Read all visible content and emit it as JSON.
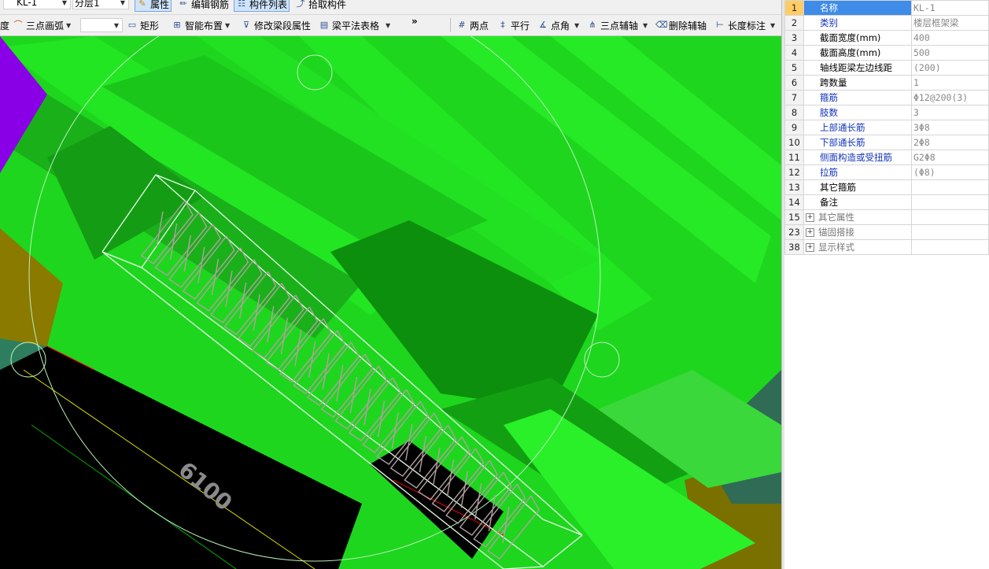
{
  "toolbar1": {
    "component_select": "KL-1",
    "layer_select": "分层1",
    "properties_label": "属性",
    "edit_rebar_label": "编辑钢筋",
    "component_list_label": "构件列表",
    "pick_component_label": "拾取构件"
  },
  "toolbar2": {
    "cut_text": "度",
    "arc_label": "三点画弧",
    "empty_combo": "",
    "rect_label": "矩形",
    "smart_layout_label": "智能布置",
    "modify_span_label": "修改梁段属性",
    "beam_table_label": "梁平法表格",
    "more_label": "»",
    "two_points_label": "两点",
    "parallel_label": "平行",
    "point_angle_label": "点角",
    "three_point_axis_label": "三点辅轴",
    "delete_axis_label": "删除辅轴",
    "length_dim_label": "长度标注"
  },
  "viewport": {
    "axis_text": "6100"
  },
  "properties": {
    "rows": [
      {
        "num": "1",
        "name": "名称",
        "value": "KL-1",
        "style": "selected"
      },
      {
        "num": "2",
        "name": "类别",
        "value": "楼层框架梁",
        "style": "blue"
      },
      {
        "num": "3",
        "name": "截面宽度(mm)",
        "value": "400",
        "style": "normal"
      },
      {
        "num": "4",
        "name": "截面高度(mm)",
        "value": "500",
        "style": "normal"
      },
      {
        "num": "5",
        "name": "轴线距梁左边线距",
        "value": "(200)",
        "style": "normal"
      },
      {
        "num": "6",
        "name": "跨数量",
        "value": "1",
        "style": "normal"
      },
      {
        "num": "7",
        "name": "箍筋",
        "value": "Φ12@200(3)",
        "style": "blue"
      },
      {
        "num": "8",
        "name": "肢数",
        "value": "3",
        "style": "blue"
      },
      {
        "num": "9",
        "name": "上部通长筋",
        "value": "3Φ8",
        "style": "blue"
      },
      {
        "num": "10",
        "name": "下部通长筋",
        "value": "2Φ8",
        "style": "blue"
      },
      {
        "num": "11",
        "name": "侧面构造或受扭筋",
        "value": "G2Φ8",
        "style": "blue"
      },
      {
        "num": "12",
        "name": "拉筋",
        "value": "(Φ8)",
        "style": "blue"
      },
      {
        "num": "13",
        "name": "其它箍筋",
        "value": "",
        "style": "normal"
      },
      {
        "num": "14",
        "name": "备注",
        "value": "",
        "style": "normal"
      },
      {
        "num": "15",
        "name": "其它属性",
        "value": "",
        "style": "group"
      },
      {
        "num": "23",
        "name": "锚固搭接",
        "value": "",
        "style": "group"
      },
      {
        "num": "38",
        "name": "显示样式",
        "value": "",
        "style": "group"
      }
    ]
  },
  "colors": {
    "viewport_green": "#1ed61e",
    "selection_blue": "#3e8be8",
    "property_blue_text": "#1033b8"
  }
}
